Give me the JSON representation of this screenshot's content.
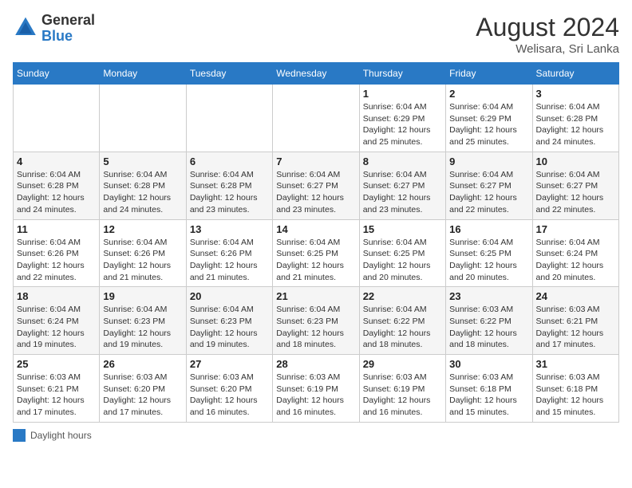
{
  "header": {
    "logo_general": "General",
    "logo_blue": "Blue",
    "month_year": "August 2024",
    "location": "Welisara, Sri Lanka"
  },
  "days_of_week": [
    "Sunday",
    "Monday",
    "Tuesday",
    "Wednesday",
    "Thursday",
    "Friday",
    "Saturday"
  ],
  "legend": {
    "label": "Daylight hours"
  },
  "weeks": [
    {
      "days": [
        {
          "num": "",
          "sunrise": "",
          "sunset": "",
          "daylight": ""
        },
        {
          "num": "",
          "sunrise": "",
          "sunset": "",
          "daylight": ""
        },
        {
          "num": "",
          "sunrise": "",
          "sunset": "",
          "daylight": ""
        },
        {
          "num": "",
          "sunrise": "",
          "sunset": "",
          "daylight": ""
        },
        {
          "num": "1",
          "sunrise": "Sunrise: 6:04 AM",
          "sunset": "Sunset: 6:29 PM",
          "daylight": "Daylight: 12 hours and 25 minutes."
        },
        {
          "num": "2",
          "sunrise": "Sunrise: 6:04 AM",
          "sunset": "Sunset: 6:29 PM",
          "daylight": "Daylight: 12 hours and 25 minutes."
        },
        {
          "num": "3",
          "sunrise": "Sunrise: 6:04 AM",
          "sunset": "Sunset: 6:28 PM",
          "daylight": "Daylight: 12 hours and 24 minutes."
        }
      ]
    },
    {
      "days": [
        {
          "num": "4",
          "sunrise": "Sunrise: 6:04 AM",
          "sunset": "Sunset: 6:28 PM",
          "daylight": "Daylight: 12 hours and 24 minutes."
        },
        {
          "num": "5",
          "sunrise": "Sunrise: 6:04 AM",
          "sunset": "Sunset: 6:28 PM",
          "daylight": "Daylight: 12 hours and 24 minutes."
        },
        {
          "num": "6",
          "sunrise": "Sunrise: 6:04 AM",
          "sunset": "Sunset: 6:28 PM",
          "daylight": "Daylight: 12 hours and 23 minutes."
        },
        {
          "num": "7",
          "sunrise": "Sunrise: 6:04 AM",
          "sunset": "Sunset: 6:27 PM",
          "daylight": "Daylight: 12 hours and 23 minutes."
        },
        {
          "num": "8",
          "sunrise": "Sunrise: 6:04 AM",
          "sunset": "Sunset: 6:27 PM",
          "daylight": "Daylight: 12 hours and 23 minutes."
        },
        {
          "num": "9",
          "sunrise": "Sunrise: 6:04 AM",
          "sunset": "Sunset: 6:27 PM",
          "daylight": "Daylight: 12 hours and 22 minutes."
        },
        {
          "num": "10",
          "sunrise": "Sunrise: 6:04 AM",
          "sunset": "Sunset: 6:27 PM",
          "daylight": "Daylight: 12 hours and 22 minutes."
        }
      ]
    },
    {
      "days": [
        {
          "num": "11",
          "sunrise": "Sunrise: 6:04 AM",
          "sunset": "Sunset: 6:26 PM",
          "daylight": "Daylight: 12 hours and 22 minutes."
        },
        {
          "num": "12",
          "sunrise": "Sunrise: 6:04 AM",
          "sunset": "Sunset: 6:26 PM",
          "daylight": "Daylight: 12 hours and 21 minutes."
        },
        {
          "num": "13",
          "sunrise": "Sunrise: 6:04 AM",
          "sunset": "Sunset: 6:26 PM",
          "daylight": "Daylight: 12 hours and 21 minutes."
        },
        {
          "num": "14",
          "sunrise": "Sunrise: 6:04 AM",
          "sunset": "Sunset: 6:25 PM",
          "daylight": "Daylight: 12 hours and 21 minutes."
        },
        {
          "num": "15",
          "sunrise": "Sunrise: 6:04 AM",
          "sunset": "Sunset: 6:25 PM",
          "daylight": "Daylight: 12 hours and 20 minutes."
        },
        {
          "num": "16",
          "sunrise": "Sunrise: 6:04 AM",
          "sunset": "Sunset: 6:25 PM",
          "daylight": "Daylight: 12 hours and 20 minutes."
        },
        {
          "num": "17",
          "sunrise": "Sunrise: 6:04 AM",
          "sunset": "Sunset: 6:24 PM",
          "daylight": "Daylight: 12 hours and 20 minutes."
        }
      ]
    },
    {
      "days": [
        {
          "num": "18",
          "sunrise": "Sunrise: 6:04 AM",
          "sunset": "Sunset: 6:24 PM",
          "daylight": "Daylight: 12 hours and 19 minutes."
        },
        {
          "num": "19",
          "sunrise": "Sunrise: 6:04 AM",
          "sunset": "Sunset: 6:23 PM",
          "daylight": "Daylight: 12 hours and 19 minutes."
        },
        {
          "num": "20",
          "sunrise": "Sunrise: 6:04 AM",
          "sunset": "Sunset: 6:23 PM",
          "daylight": "Daylight: 12 hours and 19 minutes."
        },
        {
          "num": "21",
          "sunrise": "Sunrise: 6:04 AM",
          "sunset": "Sunset: 6:23 PM",
          "daylight": "Daylight: 12 hours and 18 minutes."
        },
        {
          "num": "22",
          "sunrise": "Sunrise: 6:04 AM",
          "sunset": "Sunset: 6:22 PM",
          "daylight": "Daylight: 12 hours and 18 minutes."
        },
        {
          "num": "23",
          "sunrise": "Sunrise: 6:03 AM",
          "sunset": "Sunset: 6:22 PM",
          "daylight": "Daylight: 12 hours and 18 minutes."
        },
        {
          "num": "24",
          "sunrise": "Sunrise: 6:03 AM",
          "sunset": "Sunset: 6:21 PM",
          "daylight": "Daylight: 12 hours and 17 minutes."
        }
      ]
    },
    {
      "days": [
        {
          "num": "25",
          "sunrise": "Sunrise: 6:03 AM",
          "sunset": "Sunset: 6:21 PM",
          "daylight": "Daylight: 12 hours and 17 minutes."
        },
        {
          "num": "26",
          "sunrise": "Sunrise: 6:03 AM",
          "sunset": "Sunset: 6:20 PM",
          "daylight": "Daylight: 12 hours and 17 minutes."
        },
        {
          "num": "27",
          "sunrise": "Sunrise: 6:03 AM",
          "sunset": "Sunset: 6:20 PM",
          "daylight": "Daylight: 12 hours and 16 minutes."
        },
        {
          "num": "28",
          "sunrise": "Sunrise: 6:03 AM",
          "sunset": "Sunset: 6:19 PM",
          "daylight": "Daylight: 12 hours and 16 minutes."
        },
        {
          "num": "29",
          "sunrise": "Sunrise: 6:03 AM",
          "sunset": "Sunset: 6:19 PM",
          "daylight": "Daylight: 12 hours and 16 minutes."
        },
        {
          "num": "30",
          "sunrise": "Sunrise: 6:03 AM",
          "sunset": "Sunset: 6:18 PM",
          "daylight": "Daylight: 12 hours and 15 minutes."
        },
        {
          "num": "31",
          "sunrise": "Sunrise: 6:03 AM",
          "sunset": "Sunset: 6:18 PM",
          "daylight": "Daylight: 12 hours and 15 minutes."
        }
      ]
    }
  ]
}
